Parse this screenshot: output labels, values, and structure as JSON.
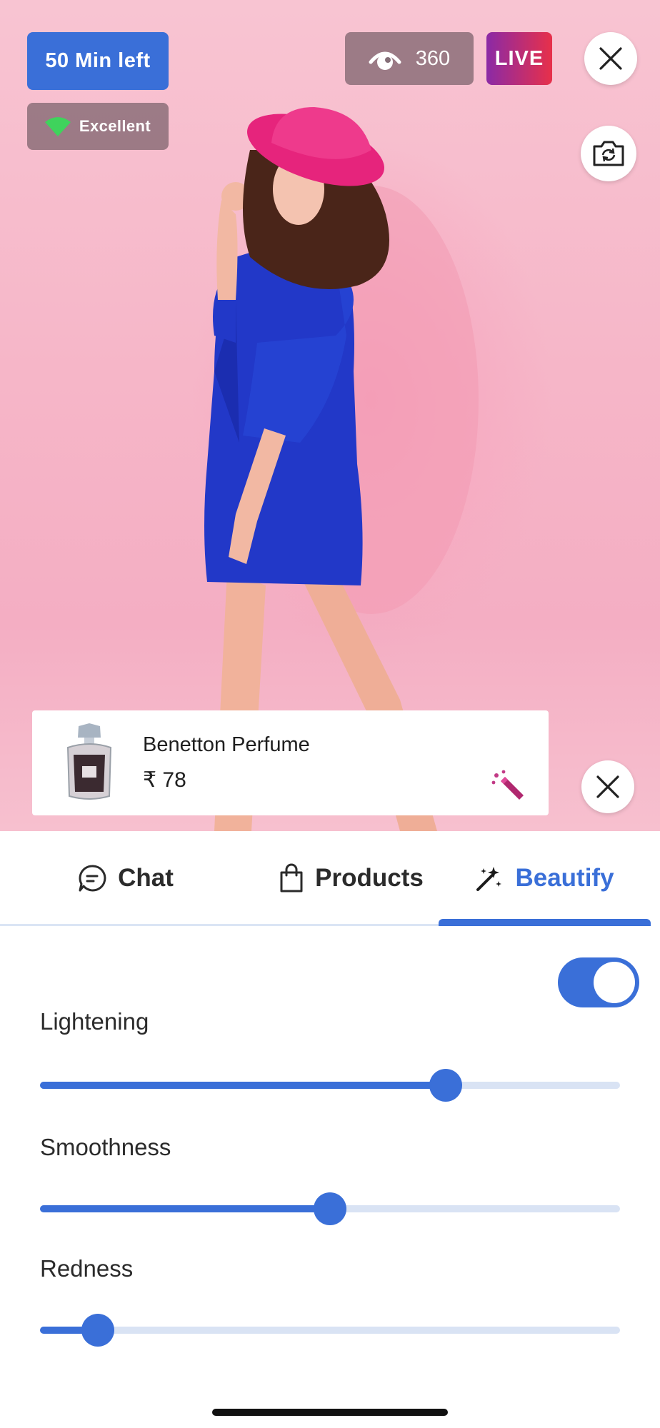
{
  "stream": {
    "time_left": "50 Min left",
    "connection": "Excellent",
    "viewers": "360",
    "live_label": "LIVE"
  },
  "product": {
    "name": "Benetton Perfume",
    "price": "₹ 78"
  },
  "tabs": [
    {
      "label": "Chat",
      "icon": "chat-bubble-icon",
      "active": false
    },
    {
      "label": "Products",
      "icon": "shopping-bag-icon",
      "active": false
    },
    {
      "label": "Beautify",
      "icon": "magic-wand-icon",
      "active": true
    }
  ],
  "beautify": {
    "enabled": true,
    "sliders": [
      {
        "label": "Lightening",
        "value": 0.7
      },
      {
        "label": "Smoothness",
        "value": 0.5
      },
      {
        "label": "Redness",
        "value": 0.1
      }
    ]
  },
  "colors": {
    "accent": "#3a6fd8",
    "live_gradient_start": "#8b2aa6",
    "live_gradient_end": "#e7304a",
    "signal_green": "#3fd35c"
  }
}
